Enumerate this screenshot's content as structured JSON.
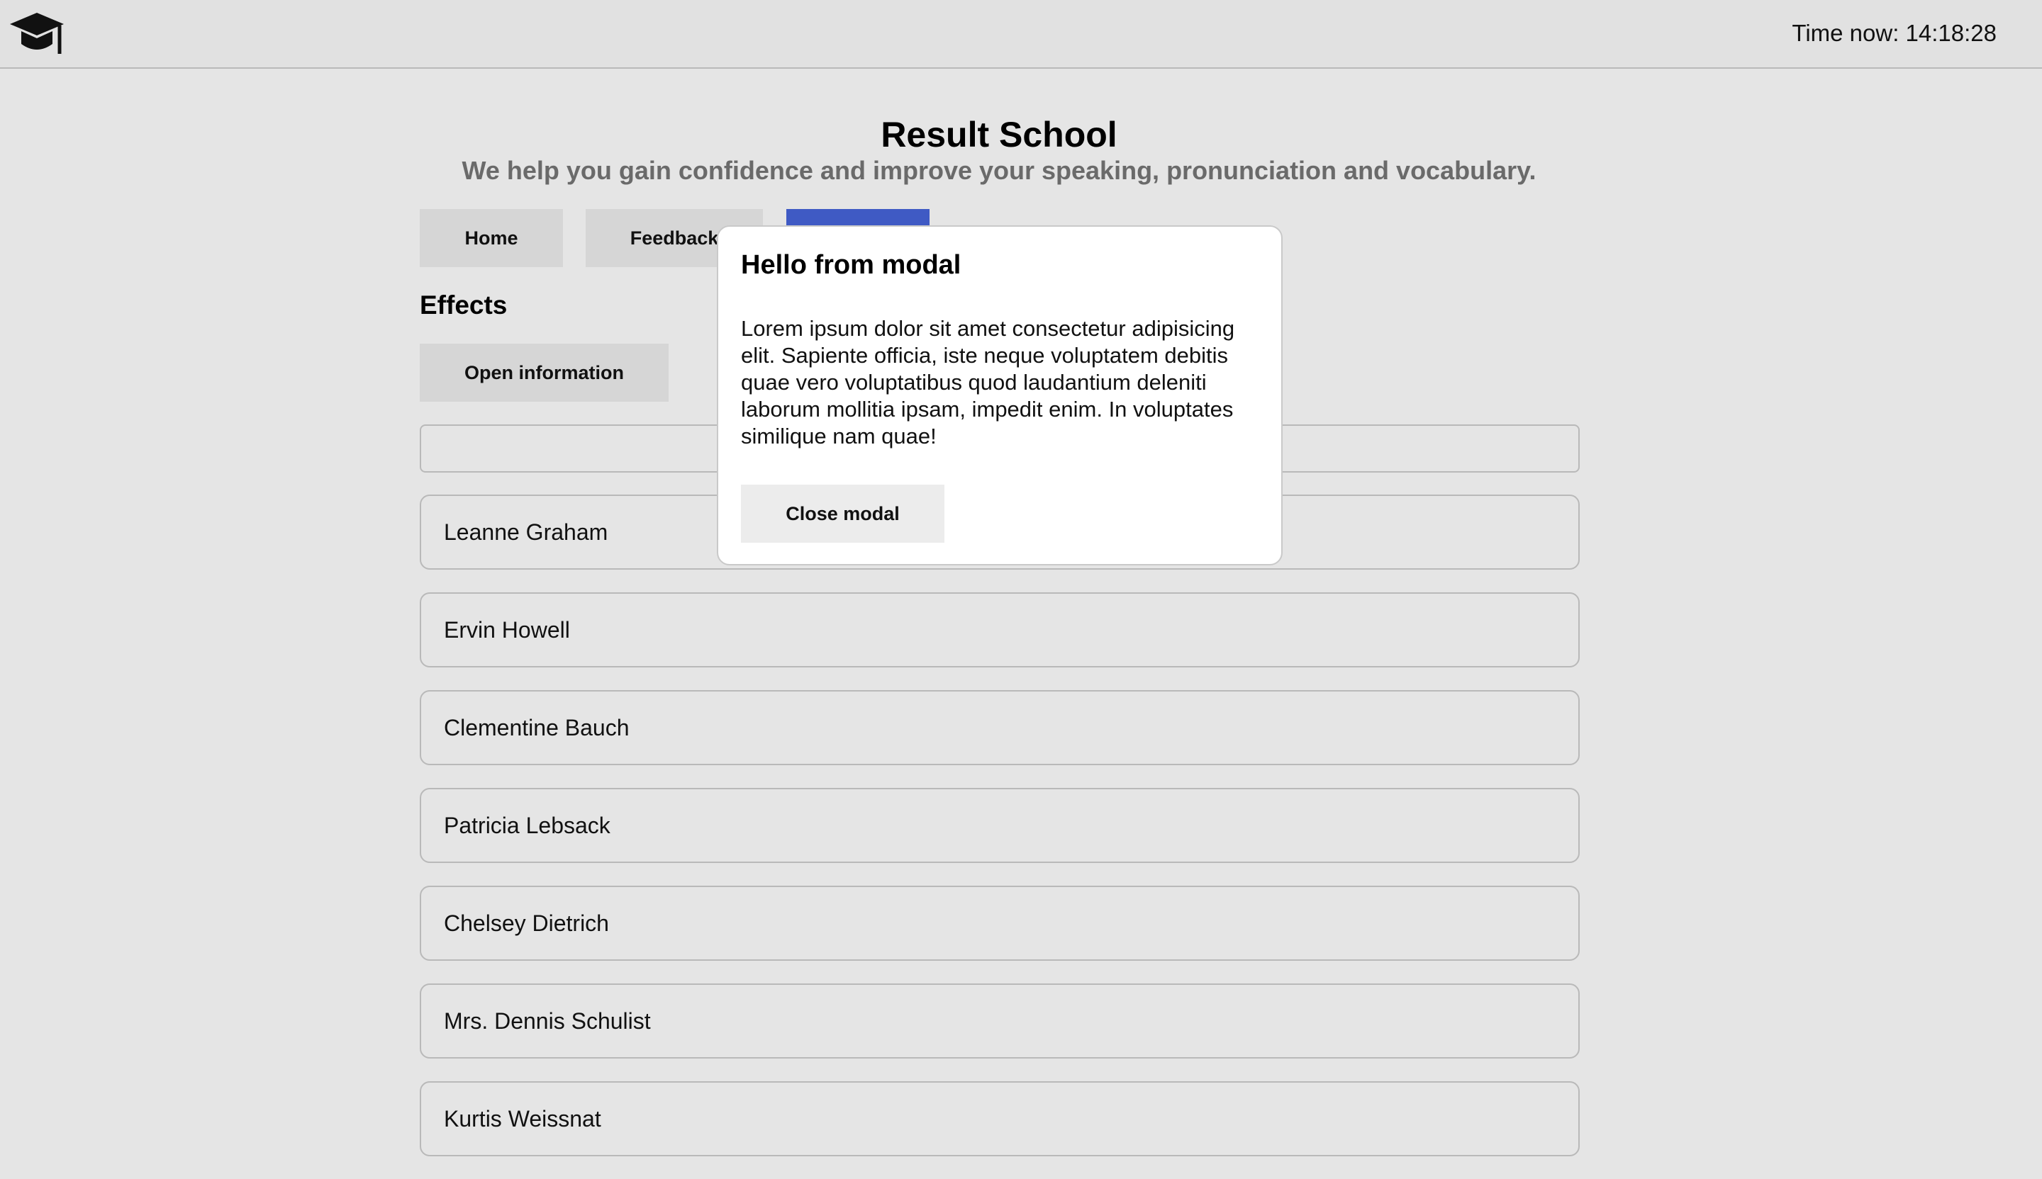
{
  "header": {
    "logo_icon": "graduation-cap-icon",
    "clock_text": "Time now: 14:18:28"
  },
  "page": {
    "title": "Result School",
    "subtitle": "We help you gain confidence and improve your speaking, pronunciation and vocabulary."
  },
  "nav": {
    "items": [
      {
        "label": "Home"
      },
      {
        "label": "Feedback"
      },
      {
        "label": "",
        "active": true
      }
    ],
    "active_color": "#3f5ac4"
  },
  "section": {
    "title": "Effects",
    "open_button": "Open information"
  },
  "search": {
    "value": "",
    "placeholder": ""
  },
  "users": [
    "Leanne Graham",
    "Ervin Howell",
    "Clementine Bauch",
    "Patricia Lebsack",
    "Chelsey Dietrich",
    "Mrs. Dennis Schulist",
    "Kurtis Weissnat"
  ],
  "modal": {
    "title": "Hello from modal",
    "body": "Lorem ipsum dolor sit amet consectetur adipisicing elit. Sapiente officia, iste neque voluptatem debitis quae vero voluptatibus quod laudantium deleniti laborum mollitia ipsam, impedit enim. In voluptates similique nam quae!",
    "close_label": "Close modal"
  }
}
